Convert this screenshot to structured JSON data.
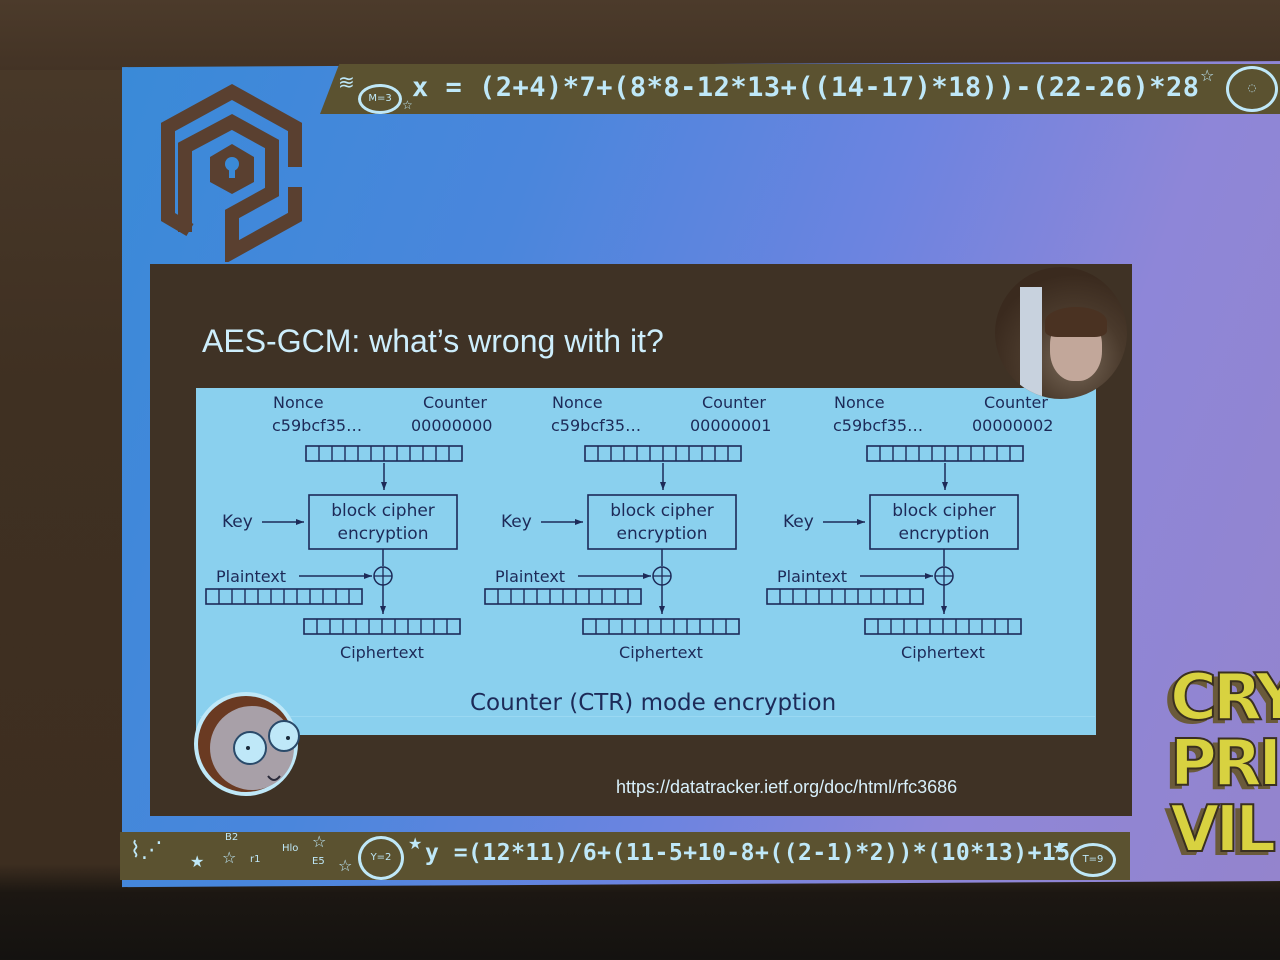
{
  "slide": {
    "title": "AES-GCM: what’s wrong with it?",
    "top_equation": "x = (2+4)*7+(8*8-12*13+((14-17)*18))-(22-26)*28",
    "top_equation_prefix_bubble": "M=3",
    "bottom_equation": "y =(12*11)/6+(11-5+10-8+((2-1)*2))*(10*13)+15",
    "bottom_equation_prefix_bubble": "Y=2",
    "bottom_doodles": [
      "B2",
      "Hlo",
      "E5",
      "r1"
    ],
    "end_bubble_bottom": "T=9",
    "reference_url": "https://datatracker.ietf.org/doc/html/rfc3686",
    "corner_logo_text": [
      "CRY",
      "PRI",
      "VIL"
    ],
    "diagram": {
      "caption": "Counter (CTR) mode encryption",
      "blocks": [
        {
          "nonce_label": "Nonce",
          "nonce_value": "c59bcf35…",
          "counter_label": "Counter",
          "counter_value": "00000000",
          "key_label": "Key",
          "cipher_line1": "block cipher",
          "cipher_line2": "encryption",
          "plaintext_label": "Plaintext",
          "ciphertext_label": "Ciphertext"
        },
        {
          "nonce_label": "Nonce",
          "nonce_value": "c59bcf35…",
          "counter_label": "Counter",
          "counter_value": "00000001",
          "key_label": "Key",
          "cipher_line1": "block cipher",
          "cipher_line2": "encryption",
          "plaintext_label": "Plaintext",
          "ciphertext_label": "Ciphertext"
        },
        {
          "nonce_label": "Nonce",
          "nonce_value": "c59bcf35…",
          "counter_label": "Counter",
          "counter_value": "00000002",
          "key_label": "Key",
          "cipher_line1": "block cipher",
          "cipher_line2": "encryption",
          "plaintext_label": "Plaintext",
          "ciphertext_label": "Ciphertext"
        }
      ]
    }
  },
  "colors": {
    "diagram_bg": "#8ad0ee",
    "diagram_ink": "#1d2a58",
    "panel_bg": "#3f3225",
    "band_bg": "#5b5230",
    "chalk": "#bfe8f8"
  }
}
